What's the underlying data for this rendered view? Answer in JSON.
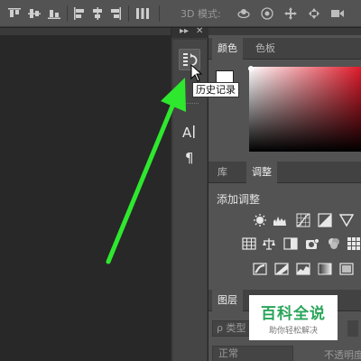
{
  "toolbar": {
    "mode_label": "3D 模式:",
    "icons": [
      "align-top-icon",
      "align-vcenter-icon",
      "align-bottom-icon",
      "align-left-icon",
      "align-hcenter-icon",
      "align-right-icon",
      "distribute-icon",
      "3d-orbit-icon",
      "3d-roll-icon",
      "3d-pan-icon",
      "3d-slide-icon",
      "3d-video-icon"
    ]
  },
  "dock": {
    "collapse_label": "▸▸",
    "close_label": "✕",
    "tooltip": "历史记录",
    "buttons": [
      "history-icon",
      "character-icon",
      "paragraph-icon"
    ]
  },
  "color_panel": {
    "tabs": [
      "颜色",
      "色板"
    ],
    "active_tab": "颜色",
    "foreground_color": "#ffffff"
  },
  "adjustments_panel": {
    "tabs": [
      "库",
      "调整"
    ],
    "active_tab": "调整",
    "title": "添加调整"
  },
  "layers_panel": {
    "tabs": [
      "图层"
    ],
    "search_placeholder": "ρ 类型",
    "blend_mode": "正常",
    "opacity_label": "不透明度"
  },
  "watermark": {
    "title": "百科全说",
    "subtitle": "助你轻松解决"
  },
  "colors": {
    "accent_arrow": "#2ee82e",
    "panel_bg": "#535353",
    "canvas_bg": "#282828"
  }
}
